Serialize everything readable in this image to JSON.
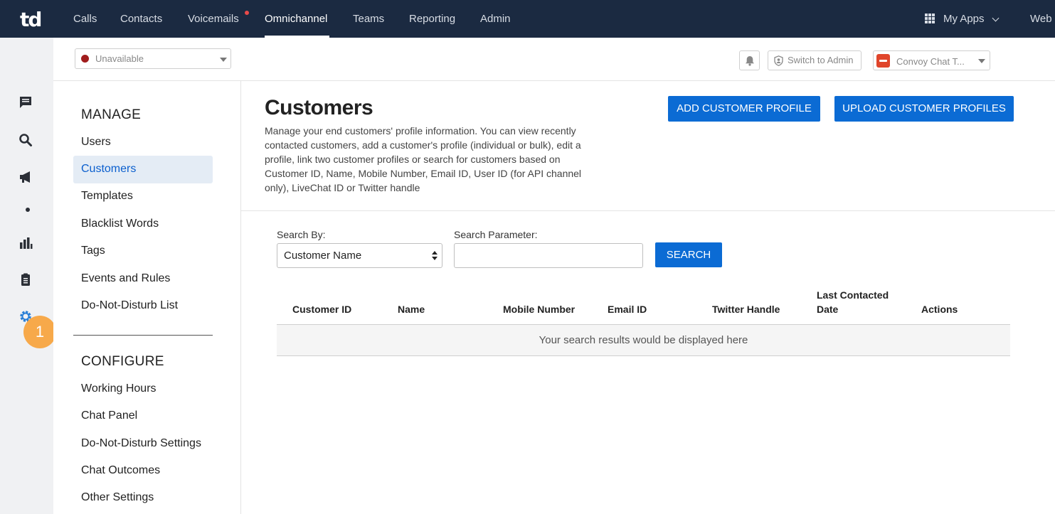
{
  "app": {
    "logo_text": "td"
  },
  "nav": {
    "items": [
      {
        "label": "Calls"
      },
      {
        "label": "Contacts"
      },
      {
        "label": "Voicemails"
      },
      {
        "label": "Omnichannel"
      },
      {
        "label": "Teams"
      },
      {
        "label": "Reporting"
      },
      {
        "label": "Admin"
      }
    ],
    "active": "Omnichannel",
    "my_apps_label": "My Apps",
    "web_label": "Web"
  },
  "rail": {
    "icons": [
      "chat-icon",
      "search-icon",
      "megaphone-icon",
      "dot-icon",
      "bar-chart-icon",
      "clipboard-icon",
      "gear-icon"
    ],
    "badge": "1"
  },
  "subheader": {
    "status_label": "Unavailable",
    "status_color": "#a11d1d",
    "switch_label": "Switch to Admin",
    "widget_label": "Convoy Chat T..."
  },
  "menu": {
    "manage_title": "MANAGE",
    "manage_items": [
      {
        "label": "Users"
      },
      {
        "label": "Customers"
      },
      {
        "label": "Templates"
      },
      {
        "label": "Blacklist Words"
      },
      {
        "label": "Tags"
      },
      {
        "label": "Events and Rules"
      },
      {
        "label": "Do-Not-Disturb List"
      }
    ],
    "configure_title": "CONFIGURE",
    "configure_items": [
      {
        "label": "Working Hours"
      },
      {
        "label": "Chat Panel"
      },
      {
        "label": "Do-Not-Disturb Settings"
      },
      {
        "label": "Chat Outcomes"
      },
      {
        "label": "Other Settings"
      }
    ]
  },
  "main": {
    "title": "Customers",
    "description": "Manage your end customers' profile information. You can view recently contacted customers, add a customer's profile (individual or bulk), edit a profile, link two customer profiles or search for customers based on Customer ID, Name, Mobile Number, Email ID, User ID (for API channel only), LiveChat ID or Twitter handle",
    "add_button": "ADD CUSTOMER PROFILE",
    "upload_button": "UPLOAD CUSTOMER PROFILES",
    "search_by_label": "Search By:",
    "search_by_value": "Customer Name",
    "search_param_label": "Search Parameter:",
    "search_param_value": "",
    "search_button": "SEARCH",
    "columns": [
      "Customer ID",
      "Name",
      "Mobile Number",
      "Email ID",
      "Twitter Handle",
      "Last Contacted Date",
      "Actions"
    ],
    "empty_message": "Your search results would be displayed here"
  },
  "colors": {
    "topbar": "#1b2a41",
    "accent": "#0b6bd4",
    "badge": "#f7a94a",
    "active_menu_bg": "#e4ecf5"
  }
}
